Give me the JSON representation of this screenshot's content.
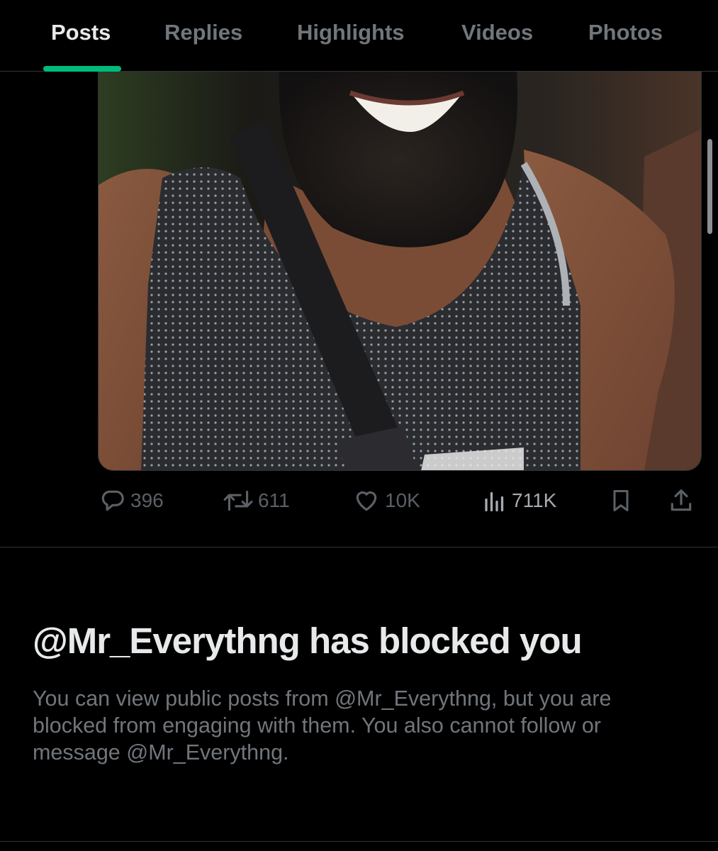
{
  "tabs": [
    {
      "label": "Posts",
      "active": true
    },
    {
      "label": "Replies",
      "active": false
    },
    {
      "label": "Highlights",
      "active": false
    },
    {
      "label": "Videos",
      "active": false
    },
    {
      "label": "Photos",
      "active": false
    }
  ],
  "accent_color": "#00ba7c",
  "post": {
    "image_icon": "photo-image",
    "actions": {
      "reply": {
        "icon": "reply-icon",
        "count": "396"
      },
      "repost": {
        "icon": "repost-icon",
        "count": "611"
      },
      "like": {
        "icon": "heart-icon",
        "count": "10K"
      },
      "views": {
        "icon": "views-icon",
        "count": "711K"
      },
      "bookmark": {
        "icon": "bookmark-icon"
      },
      "share": {
        "icon": "share-icon"
      }
    }
  },
  "blocked": {
    "title": "@Mr_Everythng has blocked you",
    "body_line1": "You can view public posts from @Mr_Everythng, but you are",
    "body_line2": "blocked from engaging with them. You also cannot follow or",
    "body_line3": "message @Mr_Everythng."
  }
}
